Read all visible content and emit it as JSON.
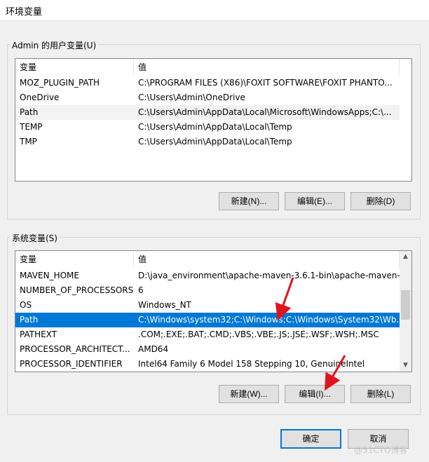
{
  "window": {
    "title": "环境变量"
  },
  "user_vars": {
    "group_label": "Admin 的用户变量(U)",
    "columns": [
      "变量",
      "值"
    ],
    "rows": [
      {
        "name": "MOZ_PLUGIN_PATH",
        "value": "C:\\PROGRAM FILES (X86)\\FOXIT SOFTWARE\\FOXIT PHANTO..."
      },
      {
        "name": "OneDrive",
        "value": "C:\\Users\\Admin\\OneDrive"
      },
      {
        "name": "Path",
        "value": "C:\\Users\\Admin\\AppData\\Local\\Microsoft\\WindowsApps;C:\\..."
      },
      {
        "name": "TEMP",
        "value": "C:\\Users\\Admin\\AppData\\Local\\Temp"
      },
      {
        "name": "TMP",
        "value": "C:\\Users\\Admin\\AppData\\Local\\Temp"
      }
    ],
    "buttons": {
      "new": "新建(N)...",
      "edit": "编辑(E)...",
      "delete": "删除(D)"
    }
  },
  "system_vars": {
    "group_label": "系统变量(S)",
    "columns": [
      "变量",
      "值"
    ],
    "rows": [
      {
        "name": "MAVEN_HOME",
        "value": "D:\\java_environment\\apache-maven-3.6.1-bin\\apache-maven-..."
      },
      {
        "name": "NUMBER_OF_PROCESSORS",
        "value": "6"
      },
      {
        "name": "OS",
        "value": "Windows_NT"
      },
      {
        "name": "Path",
        "value": "C:\\Windows\\system32;C:\\Windows;C:\\Windows\\System32\\Wb..."
      },
      {
        "name": "PATHEXT",
        "value": ".COM;.EXE;.BAT;.CMD;.VBS;.VBE;.JS;.JSE;.WSF;.WSH;.MSC"
      },
      {
        "name": "PROCESSOR_ARCHITECT...",
        "value": "AMD64"
      },
      {
        "name": "PROCESSOR_IDENTIFIER",
        "value": "Intel64 Family 6 Model 158 Stepping 10, GenuineIntel"
      }
    ],
    "selected_variable": "Path",
    "buttons": {
      "new": "新建(W)...",
      "edit": "编辑(I)...",
      "delete": "删除(L)"
    }
  },
  "footer": {
    "ok": "确定",
    "cancel": "取消"
  },
  "colors": {
    "selection": "#0078d7",
    "arrow": "#e0141e",
    "default_button_border": "#0078d7"
  },
  "watermark": "@51CTO博客"
}
